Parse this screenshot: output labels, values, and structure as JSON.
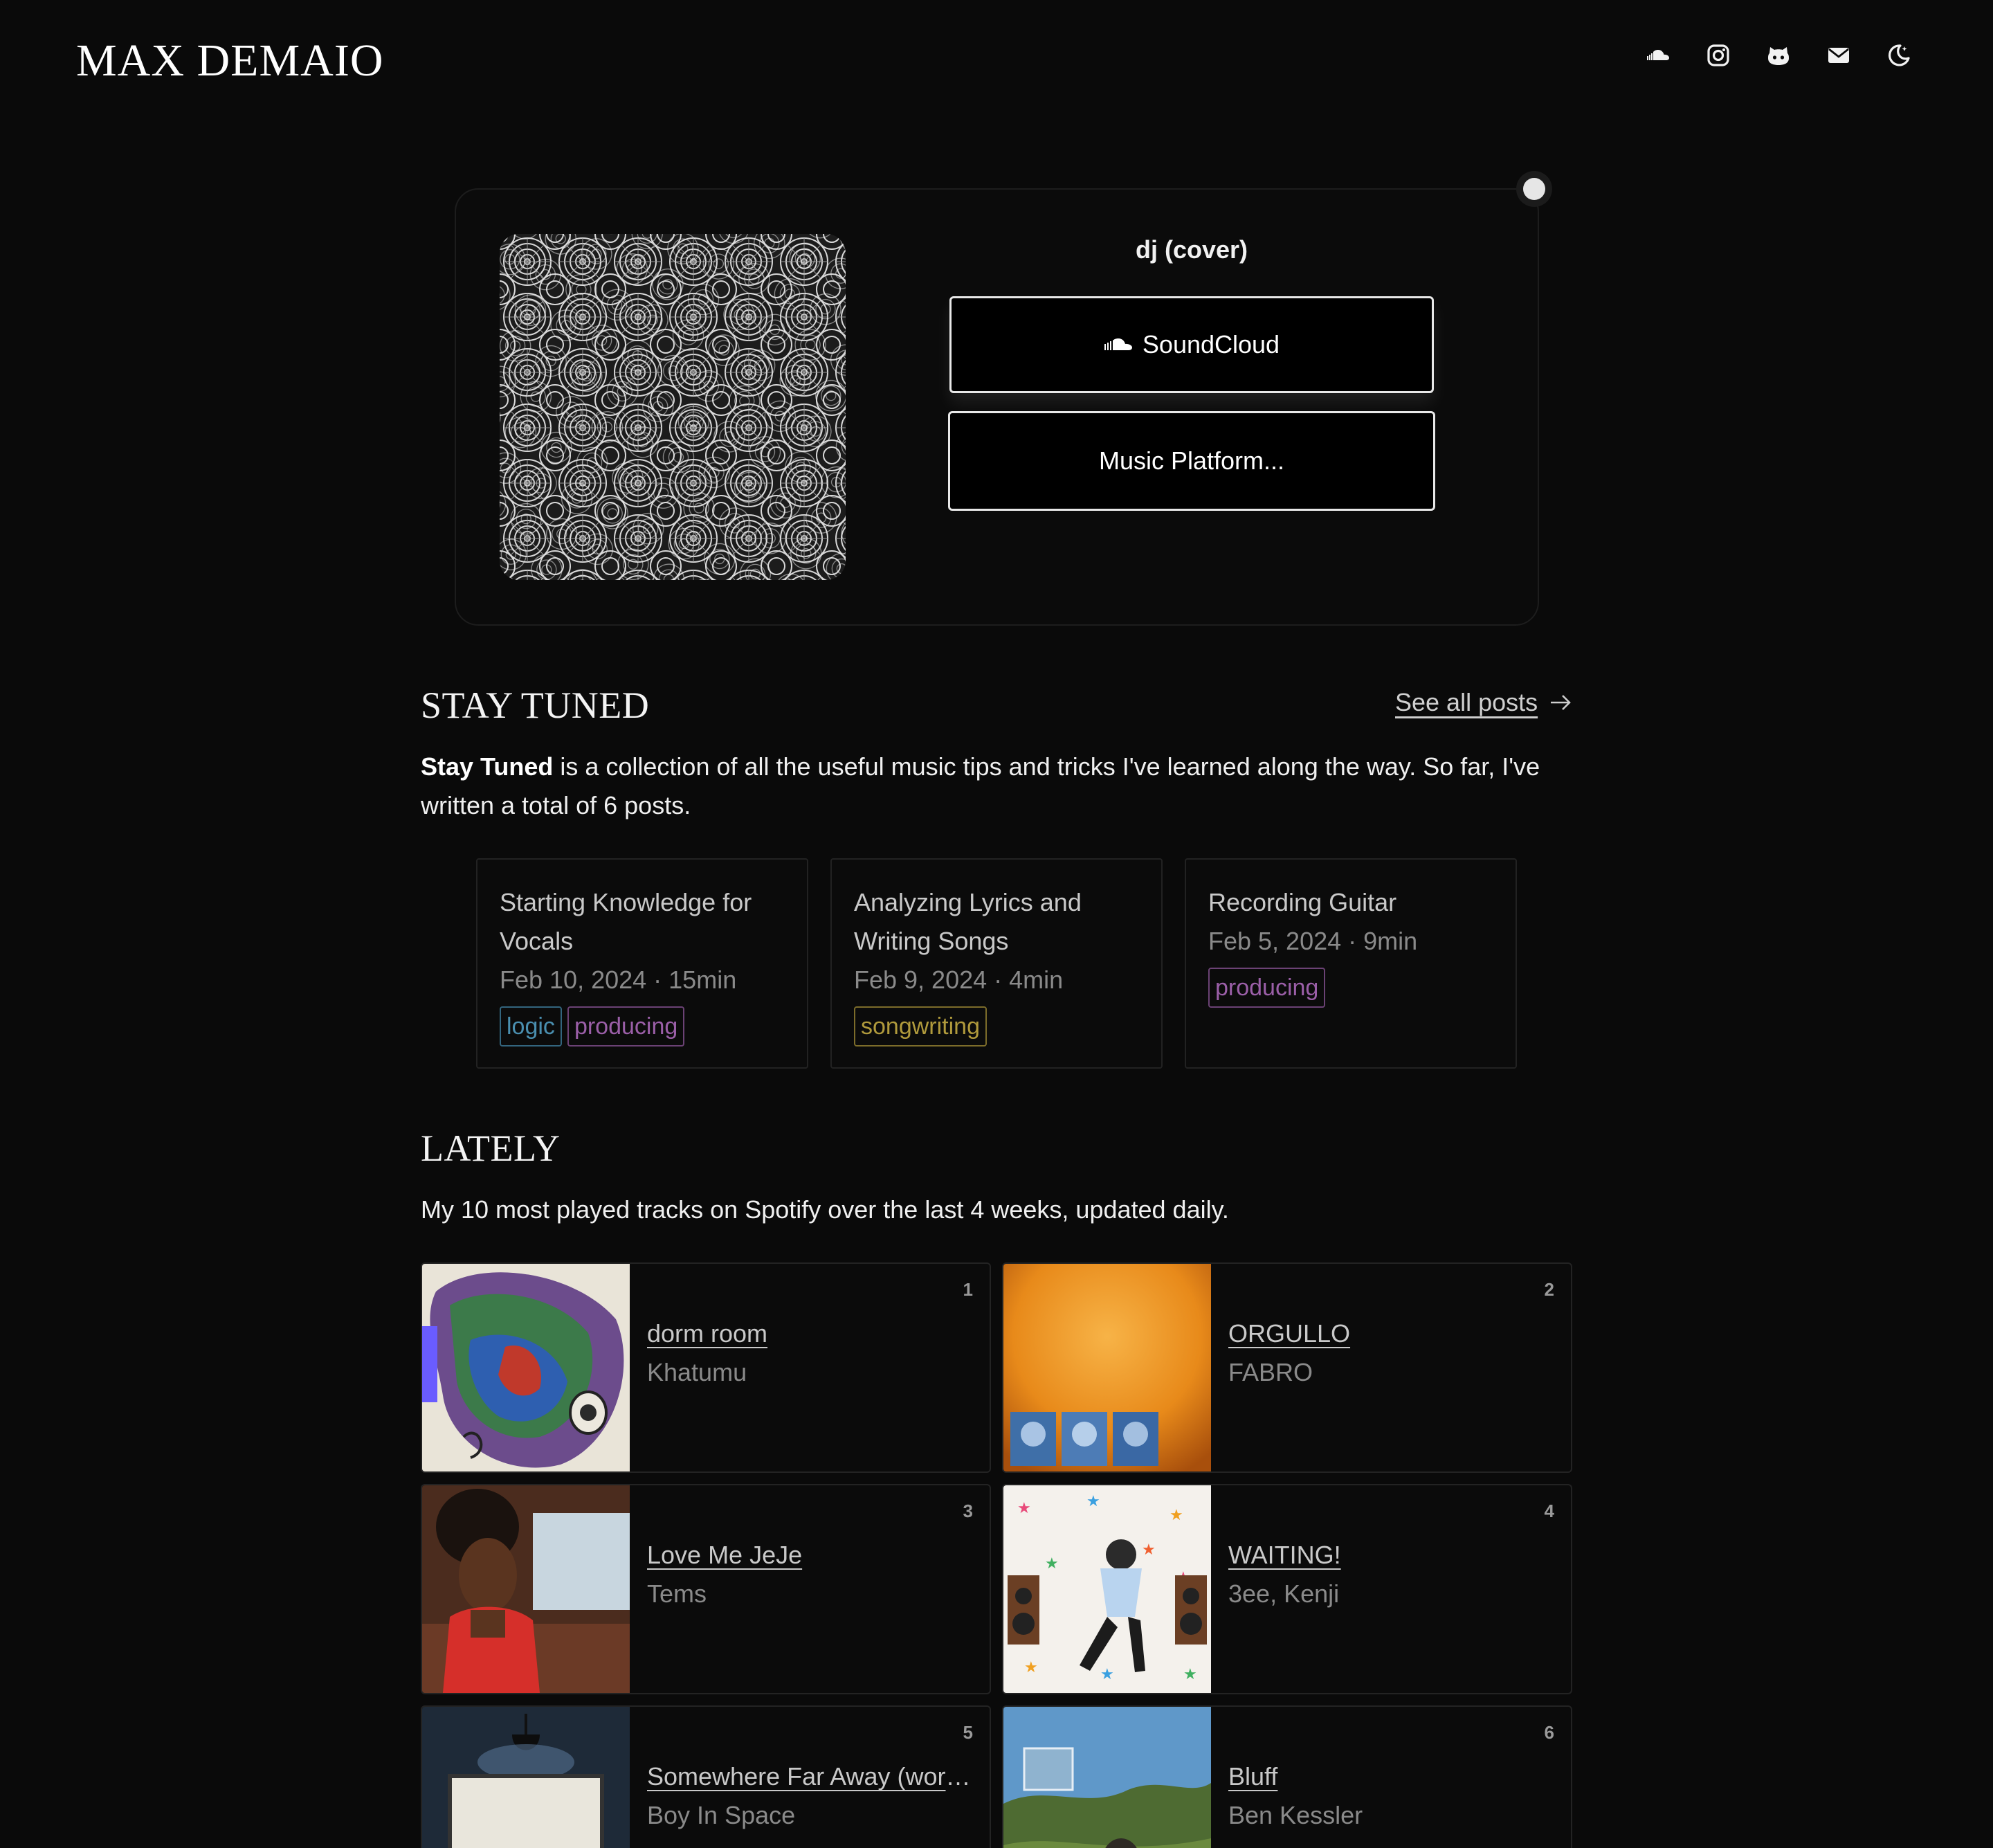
{
  "site": {
    "title": "MAX DEMAIO"
  },
  "nav": {
    "icons": [
      "soundcloud-icon",
      "instagram-icon",
      "github-icon",
      "mail-icon",
      "theme-toggle-icon"
    ]
  },
  "player": {
    "track_title": "dj (cover)",
    "soundcloud_label": "SoundCloud",
    "music_platform_label": "Music Platform..."
  },
  "stay_tuned": {
    "heading": "STAY TUNED",
    "see_all": "See all posts",
    "intro_bold": "Stay Tuned",
    "intro_rest": " is a collection of all the useful music tips and tricks I've learned along the way. So far, I've written a total of 6 posts.",
    "posts": [
      {
        "title": "Starting Knowledge for Vocals",
        "meta": "Feb 10, 2024 · 15min",
        "tags": [
          "logic",
          "producing"
        ]
      },
      {
        "title": "Analyzing Lyrics and Writing Songs",
        "meta": "Feb 9, 2024 · 4min",
        "tags": [
          "songwriting"
        ]
      },
      {
        "title": "Recording Guitar",
        "meta": "Feb 5, 2024 · 9min",
        "tags": [
          "producing"
        ]
      }
    ],
    "tag_colors": {
      "logic": "#4a8fb0",
      "producing": "#9b5fa8",
      "songwriting": "#b09a3c"
    }
  },
  "lately": {
    "heading": "LATELY",
    "intro": "My 10 most played tracks on Spotify over the last 4 weeks, updated daily.",
    "tracks": [
      {
        "rank": "1",
        "name": "dorm room",
        "artist": "Khatumu"
      },
      {
        "rank": "2",
        "name": "ORGULLO",
        "artist": "FABRO"
      },
      {
        "rank": "3",
        "name": "Love Me JeJe",
        "artist": "Tems"
      },
      {
        "rank": "4",
        "name": "WAITING!",
        "artist": "3ee, Kenji"
      },
      {
        "rank": "5",
        "name": "Somewhere Far Away (work in progress)",
        "artist": "Boy In Space"
      },
      {
        "rank": "6",
        "name": "Bluff",
        "artist": "Ben Kessler"
      }
    ]
  }
}
